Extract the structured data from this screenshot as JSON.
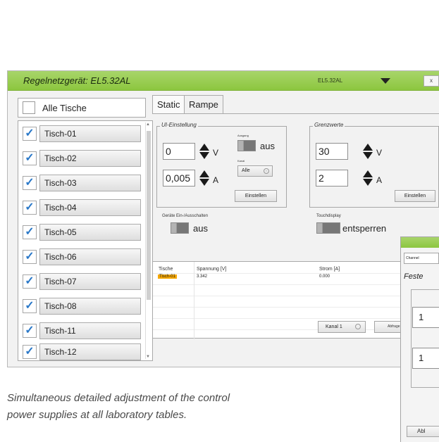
{
  "window": {
    "title": "Regelnetzgerät: EL5.32AL",
    "device_label": "EL5.32AL",
    "close_label": "x",
    "accent_color": "#8cc63f"
  },
  "tables_panel": {
    "all_label": "Alle Tische",
    "items": [
      {
        "label": "Tisch-01",
        "checked": true
      },
      {
        "label": "Tisch-02",
        "checked": true
      },
      {
        "label": "Tisch-03",
        "checked": true
      },
      {
        "label": "Tisch-04",
        "checked": true
      },
      {
        "label": "Tisch-05",
        "checked": true
      },
      {
        "label": "Tisch-06",
        "checked": true
      },
      {
        "label": "Tisch-07",
        "checked": true
      },
      {
        "label": "Tisch-08",
        "checked": true
      },
      {
        "label": "Tisch-11",
        "checked": true
      },
      {
        "label": "Tisch-12",
        "checked": true
      }
    ],
    "check_glyph": "✓"
  },
  "tabs": [
    "Static",
    "Rampe"
  ],
  "ui_settings": {
    "legend": "UI-Einstellung",
    "voltage_value": "0",
    "voltage_unit": "V",
    "current_value": "0,005",
    "current_unit": "A",
    "output_label": "Ausgang",
    "output_state": "aus",
    "channel_label": "Kanal",
    "channel_value": "Alle",
    "apply_button": "Einstellen"
  },
  "limits": {
    "legend": "Grenzwerte",
    "voltage_value": "30",
    "voltage_unit": "V",
    "current_value": "2",
    "current_unit": "A",
    "apply_button": "Einstellen"
  },
  "device_power": {
    "label": "Geräte Ein-/Ausschalten",
    "state": "aus"
  },
  "touch": {
    "label": "Touchdisplay",
    "state": "entsperren"
  },
  "measurements": {
    "columns": [
      "Tische",
      "Spannung [V]",
      "Strom [A]"
    ],
    "rows": [
      {
        "table": "Tisch-01",
        "voltage": "3.342",
        "current": "0.000"
      }
    ],
    "highlight_color": "#f6a800"
  },
  "footer": {
    "channel_select": "Kanal 1",
    "query_button": "Abfrage"
  },
  "second_window": {
    "channel_field": "Channel",
    "heading": "Feste",
    "value1": "1",
    "value2": "1",
    "button": "Abl"
  },
  "caption": {
    "line1": "Simultaneous detailed adjustment of the control",
    "line2": "power supplies at all laboratory tables."
  }
}
